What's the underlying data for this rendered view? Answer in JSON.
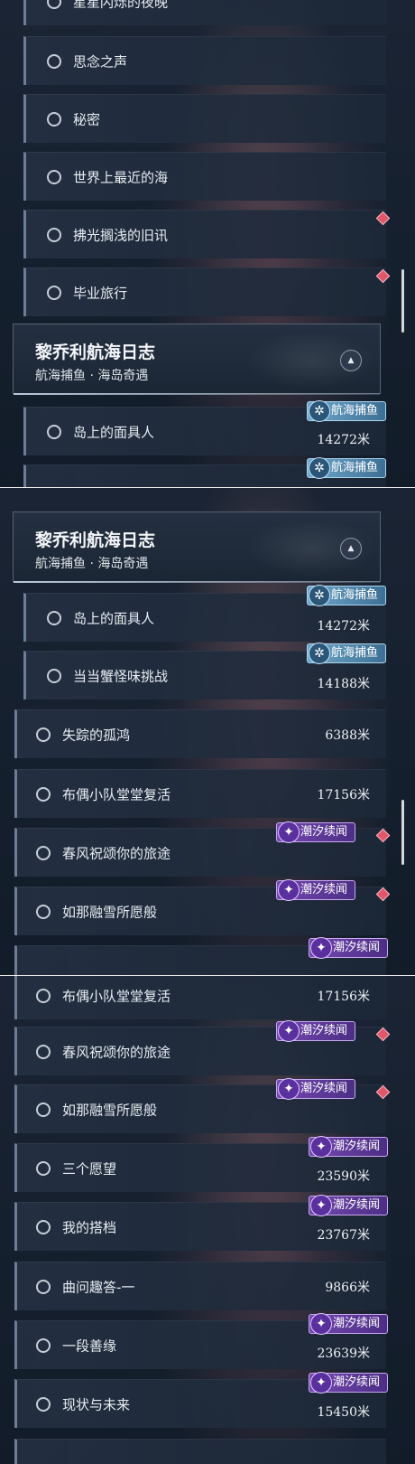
{
  "segment1": {
    "rows": [
      {
        "label": "星星闪烁的夜晚"
      },
      {
        "label": "思念之声"
      },
      {
        "label": "秘密"
      },
      {
        "label": "世界上最近的海"
      },
      {
        "label": "拂光搁浅的旧讯"
      },
      {
        "label": "毕业旅行"
      }
    ],
    "header": {
      "title": "黎乔利航海日志",
      "subtitle": "航海捕鱼 · 海岛奇遇"
    },
    "sub_rows": [
      {
        "label": "岛上的面具人",
        "distance": "14272米",
        "tag": "航海捕鱼"
      },
      {
        "tag": "航海捕鱼"
      }
    ]
  },
  "segment2": {
    "header": {
      "title": "黎乔利航海日志",
      "subtitle": "航海捕鱼 · 海岛奇遇"
    },
    "sub_rows": [
      {
        "label": "岛上的面具人",
        "distance": "14272米",
        "tag": "航海捕鱼"
      },
      {
        "label": "当当蟹怪味挑战",
        "distance": "14188米",
        "tag": "航海捕鱼"
      }
    ],
    "rows": [
      {
        "label": "失踪的孤鸿",
        "distance": "6388米"
      },
      {
        "label": "布偶小队堂堂复活",
        "distance": "17156米"
      },
      {
        "label": "春风祝颂你的旅途",
        "tag": "潮汐续闻"
      },
      {
        "label": "如那融雪所愿般",
        "tag": "潮汐续闻"
      },
      {
        "tag": "潮汐续闻"
      }
    ]
  },
  "segment3": {
    "rows": [
      {
        "label": "布偶小队堂堂复活",
        "distance": "17156米"
      },
      {
        "label": "春风祝颂你的旅途",
        "tag": "潮汐续闻"
      },
      {
        "label": "如那融雪所愿般",
        "tag": "潮汐续闻"
      },
      {
        "label": "三个愿望",
        "distance": "23590米",
        "tag": "潮汐续闻"
      },
      {
        "label": "我的搭档",
        "distance": "23767米",
        "tag": "潮汐续闻"
      },
      {
        "label": "曲问趣答-一",
        "distance": "9866米"
      },
      {
        "label": "一段善缘",
        "distance": "23639米",
        "tag": "潮汐续闻"
      },
      {
        "label": "现状与未来",
        "distance": "15450米",
        "tag": "潮汐续闻"
      }
    ]
  },
  "icons": {
    "sail_tag": "fishing-wheel-icon",
    "tide_tag": "tide-feather-icon",
    "collapse": "chevron-up-icon",
    "new_marker": "red-diamond-icon"
  },
  "colors": {
    "background": "#15202e",
    "tide_tag": "#6a40a8",
    "sail_tag": "#5a93b8",
    "new_marker": "#e0566b"
  }
}
